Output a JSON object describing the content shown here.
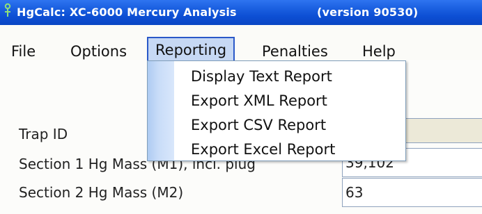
{
  "window": {
    "title": "HgCalc: XC-6000 Mercury Analysis",
    "version": "(version 90530)",
    "icon": "app-flask-icon"
  },
  "colors": {
    "titlebar": "#0d4fd4",
    "menu_active_bg": "#c6d8f4",
    "menu_active_border": "#2a58c8",
    "dropdown_stripe": "#aecbf2",
    "readonly_field": "#ece9d8"
  },
  "menubar": {
    "items": [
      {
        "label": "File"
      },
      {
        "label": "Options"
      },
      {
        "label": "Reporting",
        "active": true
      },
      {
        "label": "Penalties"
      },
      {
        "label": "Help"
      }
    ]
  },
  "reporting_menu": {
    "items": [
      {
        "label": "Display Text Report"
      },
      {
        "label": "Export XML Report"
      },
      {
        "label": "Export CSV Report"
      },
      {
        "label": "Export Excel Report"
      }
    ]
  },
  "form": {
    "trap_id": {
      "label": "Trap ID",
      "value": ""
    },
    "section1": {
      "label": "Section 1 Hg Mass (M1), incl. plug",
      "value": "39,102"
    },
    "section2": {
      "label": "Section 2 Hg Mass (M2)",
      "value": "63"
    }
  }
}
